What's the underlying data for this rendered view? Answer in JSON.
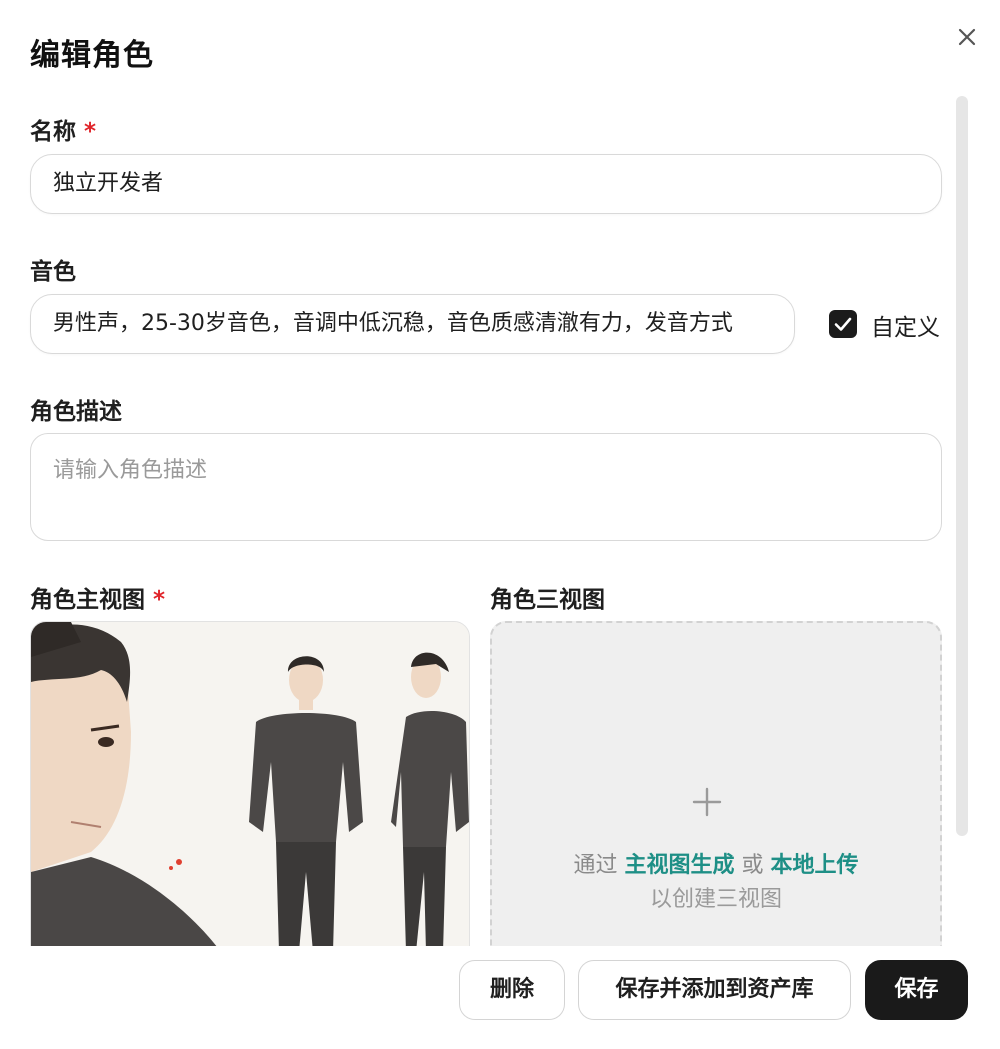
{
  "dialog": {
    "title": "编辑角色"
  },
  "fields": {
    "name": {
      "label": "名称",
      "required_mark": "*",
      "value": "独立开发者"
    },
    "voice": {
      "label": "音色",
      "value": "男性声，25-30岁音色，音调中低沉稳，音色质感清澈有力，发音方式",
      "custom_label": "自定义",
      "custom_checked": true
    },
    "description": {
      "label": "角色描述",
      "placeholder": "请输入角色描述",
      "value": ""
    },
    "main_view": {
      "label": "角色主视图",
      "required_mark": "*"
    },
    "three_view": {
      "label": "角色三视图",
      "hint_prefix": "通过",
      "hint_link1": "主视图生成",
      "hint_or": "或",
      "hint_link2": "本地上传",
      "hint_line2": "以创建三视图"
    }
  },
  "buttons": {
    "delete": "删除",
    "save_and_add": "保存并添加到资产库",
    "save": "保存"
  },
  "icons": {
    "close": "close-icon",
    "check": "check-icon",
    "plus": "plus-icon"
  },
  "colors": {
    "primary_dark": "#1a1a1a",
    "link_teal": "#1e8f86",
    "required_red": "#e0242a"
  }
}
